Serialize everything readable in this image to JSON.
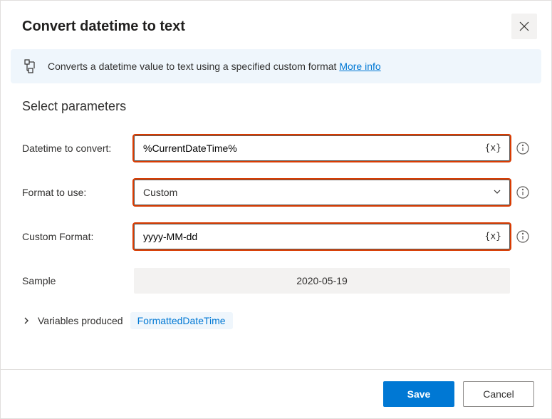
{
  "header": {
    "title": "Convert datetime to text"
  },
  "banner": {
    "text": "Converts a datetime value to text using a specified custom format ",
    "link": "More info"
  },
  "section_title": "Select parameters",
  "params": {
    "datetime": {
      "label": "Datetime to convert:",
      "value": "%CurrentDateTime%",
      "var_token": "{x}"
    },
    "format": {
      "label": "Format to use:",
      "value": "Custom"
    },
    "custom": {
      "label": "Custom Format:",
      "value": "yyyy-MM-dd",
      "var_token": "{x}"
    },
    "sample": {
      "label": "Sample",
      "value": "2020-05-19"
    }
  },
  "variables": {
    "label": "Variables produced",
    "pill": "FormattedDateTime"
  },
  "footer": {
    "save": "Save",
    "cancel": "Cancel"
  }
}
